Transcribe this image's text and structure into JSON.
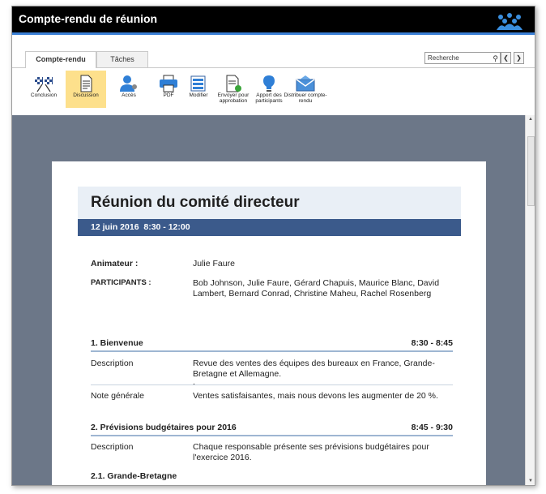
{
  "window": {
    "title": "Compte-rendu de réunion"
  },
  "tabs": [
    {
      "label": "Compte-rendu"
    },
    {
      "label": "Tâches"
    }
  ],
  "search": {
    "placeholder": "Recherche"
  },
  "nav": {
    "prev": "❮",
    "next": "❯"
  },
  "ribbon": {
    "conclusion": "Conclusion",
    "discussion": "Discussion",
    "acces": "Accès",
    "pdf": "PDF",
    "modifier": "Modifier",
    "envoyer": "Envoyer pour approbation",
    "apport": "Apport des participants",
    "distribuer": "Distribuer compte-rendu"
  },
  "document": {
    "title": "Réunion du comité directeur",
    "date": "12 juin 2016  8:30 - 12:00",
    "animateur_label": "Animateur :",
    "animateur_value": "Julie Faure",
    "participants_label": "PARTICIPANTS :",
    "participants_line1": "Bob Johnson, Julie Faure, Gérard Chapuis, Maurice Blanc, David",
    "participants_line2": "Lambert, Bernard Conrad, Christine Maheu, Rachel Rosenberg",
    "sections": [
      {
        "title": "1. Bienvenue",
        "time": "8:30 - 8:45",
        "description_label": "Description",
        "description_line1": "Revue des ventes des équipes des bureaux en France, Grande-",
        "description_line2": "Bretagne et Allemagne.",
        "description_line3": ".",
        "note_label": "Note générale",
        "note_value": "Ventes satisfaisantes, mais nous devons les augmenter de 20 %."
      },
      {
        "title": "2. Prévisions budgétaires pour 2016",
        "time": "8:45 - 9:30",
        "description_label": "Description",
        "description_line1": "Chaque responsable présente ses prévisions budgétaires pour",
        "description_line2": "l'exercice 2016."
      }
    ],
    "subsection": "2.1. Grande-Bretagne"
  }
}
